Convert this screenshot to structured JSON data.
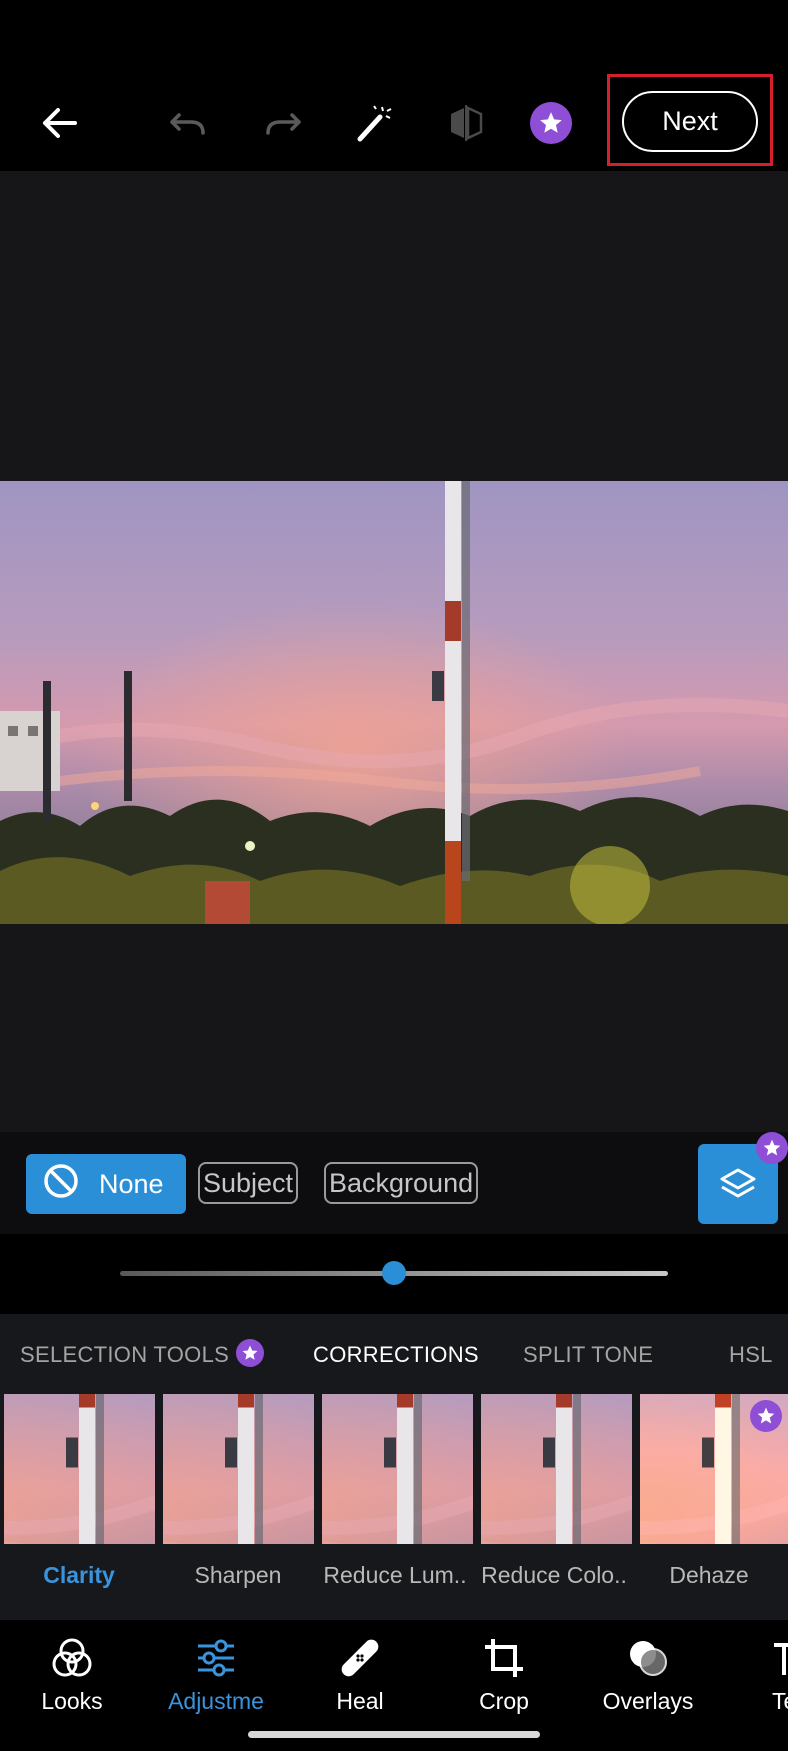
{
  "toolbar": {
    "next_label": "Next",
    "icons": [
      "back-arrow-icon",
      "undo-icon",
      "redo-icon",
      "magic-wand-icon",
      "compare-icon",
      "premium-star-icon"
    ]
  },
  "mask": {
    "none_label": "None",
    "subject_label": "Subject",
    "background_label": "Background"
  },
  "slider": {
    "value_fraction": 0.5
  },
  "categories": [
    {
      "label": "SELECTION TOOLS",
      "active": false,
      "premium": true
    },
    {
      "label": "CORRECTIONS",
      "active": true
    },
    {
      "label": "SPLIT TONE",
      "active": false
    },
    {
      "label": "HSL",
      "active": false
    }
  ],
  "presets": [
    {
      "label": "Clarity",
      "active": true
    },
    {
      "label": "Sharpen",
      "active": false
    },
    {
      "label": "Reduce Lum..",
      "active": false
    },
    {
      "label": "Reduce Colo..",
      "active": false
    },
    {
      "label": "Dehaze",
      "active": false,
      "premium": true
    }
  ],
  "nav": [
    {
      "label": "Looks",
      "icon": "looks-icon"
    },
    {
      "label": "Adjustme",
      "icon": "adjustments-icon",
      "active": true
    },
    {
      "label": "Heal",
      "icon": "bandage-icon"
    },
    {
      "label": "Crop",
      "icon": "crop-icon"
    },
    {
      "label": "Overlays",
      "icon": "overlays-icon"
    },
    {
      "label": "Te",
      "icon": "text-icon"
    }
  ],
  "colors": {
    "accent": "#2a8fd6",
    "premium": "#8e4ed6",
    "highlight_box": "#d3202e"
  }
}
